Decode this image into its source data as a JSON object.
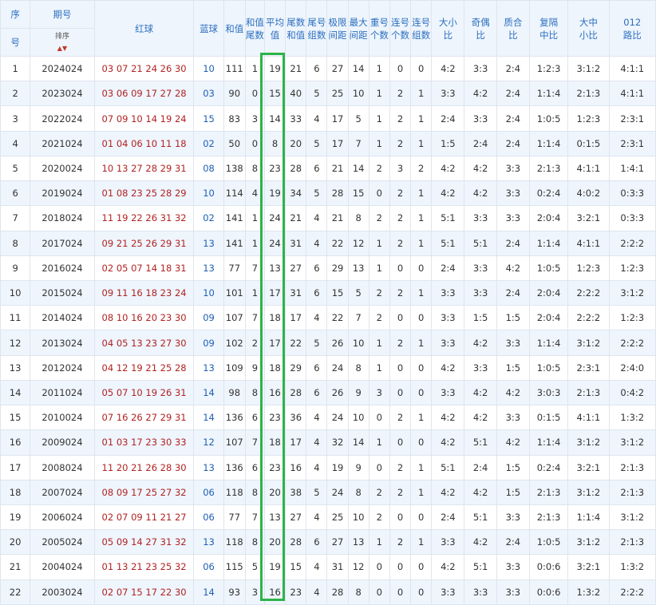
{
  "header": {
    "seq": [
      "序",
      "号"
    ],
    "period": "期号",
    "sort_label": "排序",
    "sort_arrows": "▲▼",
    "red": "红球",
    "blue": "蓝球",
    "sum": "和值",
    "sum_tail": [
      "和值",
      "尾数"
    ],
    "avg": [
      "平均",
      "值"
    ],
    "tail_sum": [
      "尾数",
      "和值"
    ],
    "tail_groups": [
      "尾号",
      "组数"
    ],
    "span": [
      "极限",
      "间距"
    ],
    "max_gap": [
      "最大",
      "间距"
    ],
    "repeat": [
      "重号",
      "个数"
    ],
    "consecutive": [
      "连号",
      "个数"
    ],
    "consec_groups": [
      "连号",
      "组数"
    ],
    "big_small": [
      "大小",
      "比"
    ],
    "odd_even": [
      "奇偶",
      "比"
    ],
    "prime": [
      "质合",
      "比"
    ],
    "repeat_gap": [
      "复隔",
      "中比"
    ],
    "big_mid_small": [
      "大中",
      "小比"
    ],
    "road": [
      "012",
      "路比"
    ]
  },
  "rows": [
    {
      "seq": "1",
      "period": "2024024",
      "red": "03 07 21 24 26 30",
      "blue": "10",
      "sum": "111",
      "sum_tail": "1",
      "avg": "19",
      "tail_sum": "21",
      "tail_groups": "6",
      "span": "27",
      "max_gap": "14",
      "repeat": "1",
      "consecutive": "0",
      "consec_groups": "0",
      "big_small": "4:2",
      "odd_even": "3:3",
      "prime": "2:4",
      "repeat_gap": "1:2:3",
      "big_mid_small": "3:1:2",
      "road": "4:1:1"
    },
    {
      "seq": "2",
      "period": "2023024",
      "red": "03 06 09 17 27 28",
      "blue": "03",
      "sum": "90",
      "sum_tail": "0",
      "avg": "15",
      "tail_sum": "40",
      "tail_groups": "5",
      "span": "25",
      "max_gap": "10",
      "repeat": "1",
      "consecutive": "2",
      "consec_groups": "1",
      "big_small": "3:3",
      "odd_even": "4:2",
      "prime": "2:4",
      "repeat_gap": "1:1:4",
      "big_mid_small": "2:1:3",
      "road": "4:1:1"
    },
    {
      "seq": "3",
      "period": "2022024",
      "red": "07 09 10 14 19 24",
      "blue": "15",
      "sum": "83",
      "sum_tail": "3",
      "avg": "14",
      "tail_sum": "33",
      "tail_groups": "4",
      "span": "17",
      "max_gap": "5",
      "repeat": "1",
      "consecutive": "2",
      "consec_groups": "1",
      "big_small": "2:4",
      "odd_even": "3:3",
      "prime": "2:4",
      "repeat_gap": "1:0:5",
      "big_mid_small": "1:2:3",
      "road": "2:3:1"
    },
    {
      "seq": "4",
      "period": "2021024",
      "red": "01 04 06 10 11 18",
      "blue": "02",
      "sum": "50",
      "sum_tail": "0",
      "avg": "8",
      "tail_sum": "20",
      "tail_groups": "5",
      "span": "17",
      "max_gap": "7",
      "repeat": "1",
      "consecutive": "2",
      "consec_groups": "1",
      "big_small": "1:5",
      "odd_even": "2:4",
      "prime": "2:4",
      "repeat_gap": "1:1:4",
      "big_mid_small": "0:1:5",
      "road": "2:3:1"
    },
    {
      "seq": "5",
      "period": "2020024",
      "red": "10 13 27 28 29 31",
      "blue": "08",
      "sum": "138",
      "sum_tail": "8",
      "avg": "23",
      "tail_sum": "28",
      "tail_groups": "6",
      "span": "21",
      "max_gap": "14",
      "repeat": "2",
      "consecutive": "3",
      "consec_groups": "2",
      "big_small": "4:2",
      "odd_even": "4:2",
      "prime": "3:3",
      "repeat_gap": "2:1:3",
      "big_mid_small": "4:1:1",
      "road": "1:4:1"
    },
    {
      "seq": "6",
      "period": "2019024",
      "red": "01 08 23 25 28 29",
      "blue": "10",
      "sum": "114",
      "sum_tail": "4",
      "avg": "19",
      "tail_sum": "34",
      "tail_groups": "5",
      "span": "28",
      "max_gap": "15",
      "repeat": "0",
      "consecutive": "2",
      "consec_groups": "1",
      "big_small": "4:2",
      "odd_even": "4:2",
      "prime": "3:3",
      "repeat_gap": "0:2:4",
      "big_mid_small": "4:0:2",
      "road": "0:3:3"
    },
    {
      "seq": "7",
      "period": "2018024",
      "red": "11 19 22 26 31 32",
      "blue": "02",
      "sum": "141",
      "sum_tail": "1",
      "avg": "24",
      "tail_sum": "21",
      "tail_groups": "4",
      "span": "21",
      "max_gap": "8",
      "repeat": "2",
      "consecutive": "2",
      "consec_groups": "1",
      "big_small": "5:1",
      "odd_even": "3:3",
      "prime": "3:3",
      "repeat_gap": "2:0:4",
      "big_mid_small": "3:2:1",
      "road": "0:3:3"
    },
    {
      "seq": "8",
      "period": "2017024",
      "red": "09 21 25 26 29 31",
      "blue": "13",
      "sum": "141",
      "sum_tail": "1",
      "avg": "24",
      "tail_sum": "31",
      "tail_groups": "4",
      "span": "22",
      "max_gap": "12",
      "repeat": "1",
      "consecutive": "2",
      "consec_groups": "1",
      "big_small": "5:1",
      "odd_even": "5:1",
      "prime": "2:4",
      "repeat_gap": "1:1:4",
      "big_mid_small": "4:1:1",
      "road": "2:2:2"
    },
    {
      "seq": "9",
      "period": "2016024",
      "red": "02 05 07 14 18 31",
      "blue": "13",
      "sum": "77",
      "sum_tail": "7",
      "avg": "13",
      "tail_sum": "27",
      "tail_groups": "6",
      "span": "29",
      "max_gap": "13",
      "repeat": "1",
      "consecutive": "0",
      "consec_groups": "0",
      "big_small": "2:4",
      "odd_even": "3:3",
      "prime": "4:2",
      "repeat_gap": "1:0:5",
      "big_mid_small": "1:2:3",
      "road": "1:2:3"
    },
    {
      "seq": "10",
      "period": "2015024",
      "red": "09 11 16 18 23 24",
      "blue": "10",
      "sum": "101",
      "sum_tail": "1",
      "avg": "17",
      "tail_sum": "31",
      "tail_groups": "6",
      "span": "15",
      "max_gap": "5",
      "repeat": "2",
      "consecutive": "2",
      "consec_groups": "1",
      "big_small": "3:3",
      "odd_even": "3:3",
      "prime": "2:4",
      "repeat_gap": "2:0:4",
      "big_mid_small": "2:2:2",
      "road": "3:1:2"
    },
    {
      "seq": "11",
      "period": "2014024",
      "red": "08 10 16 20 23 30",
      "blue": "09",
      "sum": "107",
      "sum_tail": "7",
      "avg": "18",
      "tail_sum": "17",
      "tail_groups": "4",
      "span": "22",
      "max_gap": "7",
      "repeat": "2",
      "consecutive": "0",
      "consec_groups": "0",
      "big_small": "3:3",
      "odd_even": "1:5",
      "prime": "1:5",
      "repeat_gap": "2:0:4",
      "big_mid_small": "2:2:2",
      "road": "1:2:3"
    },
    {
      "seq": "12",
      "period": "2013024",
      "red": "04 05 13 23 27 30",
      "blue": "09",
      "sum": "102",
      "sum_tail": "2",
      "avg": "17",
      "tail_sum": "22",
      "tail_groups": "5",
      "span": "26",
      "max_gap": "10",
      "repeat": "1",
      "consecutive": "2",
      "consec_groups": "1",
      "big_small": "3:3",
      "odd_even": "4:2",
      "prime": "3:3",
      "repeat_gap": "1:1:4",
      "big_mid_small": "3:1:2",
      "road": "2:2:2"
    },
    {
      "seq": "13",
      "period": "2012024",
      "red": "04 12 19 21 25 28",
      "blue": "13",
      "sum": "109",
      "sum_tail": "9",
      "avg": "18",
      "tail_sum": "29",
      "tail_groups": "6",
      "span": "24",
      "max_gap": "8",
      "repeat": "1",
      "consecutive": "0",
      "consec_groups": "0",
      "big_small": "4:2",
      "odd_even": "3:3",
      "prime": "1:5",
      "repeat_gap": "1:0:5",
      "big_mid_small": "2:3:1",
      "road": "2:4:0"
    },
    {
      "seq": "14",
      "period": "2011024",
      "red": "05 07 10 19 26 31",
      "blue": "14",
      "sum": "98",
      "sum_tail": "8",
      "avg": "16",
      "tail_sum": "28",
      "tail_groups": "6",
      "span": "26",
      "max_gap": "9",
      "repeat": "3",
      "consecutive": "0",
      "consec_groups": "0",
      "big_small": "3:3",
      "odd_even": "4:2",
      "prime": "4:2",
      "repeat_gap": "3:0:3",
      "big_mid_small": "2:1:3",
      "road": "0:4:2"
    },
    {
      "seq": "15",
      "period": "2010024",
      "red": "07 16 26 27 29 31",
      "blue": "14",
      "sum": "136",
      "sum_tail": "6",
      "avg": "23",
      "tail_sum": "36",
      "tail_groups": "4",
      "span": "24",
      "max_gap": "10",
      "repeat": "0",
      "consecutive": "2",
      "consec_groups": "1",
      "big_small": "4:2",
      "odd_even": "4:2",
      "prime": "3:3",
      "repeat_gap": "0:1:5",
      "big_mid_small": "4:1:1",
      "road": "1:3:2"
    },
    {
      "seq": "16",
      "period": "2009024",
      "red": "01 03 17 23 30 33",
      "blue": "12",
      "sum": "107",
      "sum_tail": "7",
      "avg": "18",
      "tail_sum": "17",
      "tail_groups": "4",
      "span": "32",
      "max_gap": "14",
      "repeat": "1",
      "consecutive": "0",
      "consec_groups": "0",
      "big_small": "4:2",
      "odd_even": "5:1",
      "prime": "4:2",
      "repeat_gap": "1:1:4",
      "big_mid_small": "3:1:2",
      "road": "3:1:2"
    },
    {
      "seq": "17",
      "period": "2008024",
      "red": "11 20 21 26 28 30",
      "blue": "13",
      "sum": "136",
      "sum_tail": "6",
      "avg": "23",
      "tail_sum": "16",
      "tail_groups": "4",
      "span": "19",
      "max_gap": "9",
      "repeat": "0",
      "consecutive": "2",
      "consec_groups": "1",
      "big_small": "5:1",
      "odd_even": "2:4",
      "prime": "1:5",
      "repeat_gap": "0:2:4",
      "big_mid_small": "3:2:1",
      "road": "2:1:3"
    },
    {
      "seq": "18",
      "period": "2007024",
      "red": "08 09 17 25 27 32",
      "blue": "06",
      "sum": "118",
      "sum_tail": "8",
      "avg": "20",
      "tail_sum": "38",
      "tail_groups": "5",
      "span": "24",
      "max_gap": "8",
      "repeat": "2",
      "consecutive": "2",
      "consec_groups": "1",
      "big_small": "4:2",
      "odd_even": "4:2",
      "prime": "1:5",
      "repeat_gap": "2:1:3",
      "big_mid_small": "3:1:2",
      "road": "2:1:3"
    },
    {
      "seq": "19",
      "period": "2006024",
      "red": "02 07 09 11 21 27",
      "blue": "06",
      "sum": "77",
      "sum_tail": "7",
      "avg": "13",
      "tail_sum": "27",
      "tail_groups": "4",
      "span": "25",
      "max_gap": "10",
      "repeat": "2",
      "consecutive": "0",
      "consec_groups": "0",
      "big_small": "2:4",
      "odd_even": "5:1",
      "prime": "3:3",
      "repeat_gap": "2:1:3",
      "big_mid_small": "1:1:4",
      "road": "3:1:2"
    },
    {
      "seq": "20",
      "period": "2005024",
      "red": "05 09 14 27 31 32",
      "blue": "13",
      "sum": "118",
      "sum_tail": "8",
      "avg": "20",
      "tail_sum": "28",
      "tail_groups": "6",
      "span": "27",
      "max_gap": "13",
      "repeat": "1",
      "consecutive": "2",
      "consec_groups": "1",
      "big_small": "3:3",
      "odd_even": "4:2",
      "prime": "2:4",
      "repeat_gap": "1:0:5",
      "big_mid_small": "3:1:2",
      "road": "2:1:3"
    },
    {
      "seq": "21",
      "period": "2004024",
      "red": "01 13 21 23 25 32",
      "blue": "06",
      "sum": "115",
      "sum_tail": "5",
      "avg": "19",
      "tail_sum": "15",
      "tail_groups": "4",
      "span": "31",
      "max_gap": "12",
      "repeat": "0",
      "consecutive": "0",
      "consec_groups": "0",
      "big_small": "4:2",
      "odd_even": "5:1",
      "prime": "3:3",
      "repeat_gap": "0:0:6",
      "big_mid_small": "3:2:1",
      "road": "1:3:2"
    },
    {
      "seq": "22",
      "period": "2003024",
      "red": "02 07 15 17 22 30",
      "blue": "14",
      "sum": "93",
      "sum_tail": "3",
      "avg": "16",
      "tail_sum": "23",
      "tail_groups": "4",
      "span": "28",
      "max_gap": "8",
      "repeat": "0",
      "consecutive": "0",
      "consec_groups": "0",
      "big_small": "3:3",
      "odd_even": "3:3",
      "prime": "3:3",
      "repeat_gap": "0:0:6",
      "big_mid_small": "1:3:2",
      "road": "2:2:2"
    }
  ],
  "colors": {
    "highlight": "#2db34a",
    "red_ball": "#b22222",
    "blue_ball": "#1f5fb5",
    "header_text": "#2c6fbf",
    "alt_row": "#eef5fd"
  }
}
